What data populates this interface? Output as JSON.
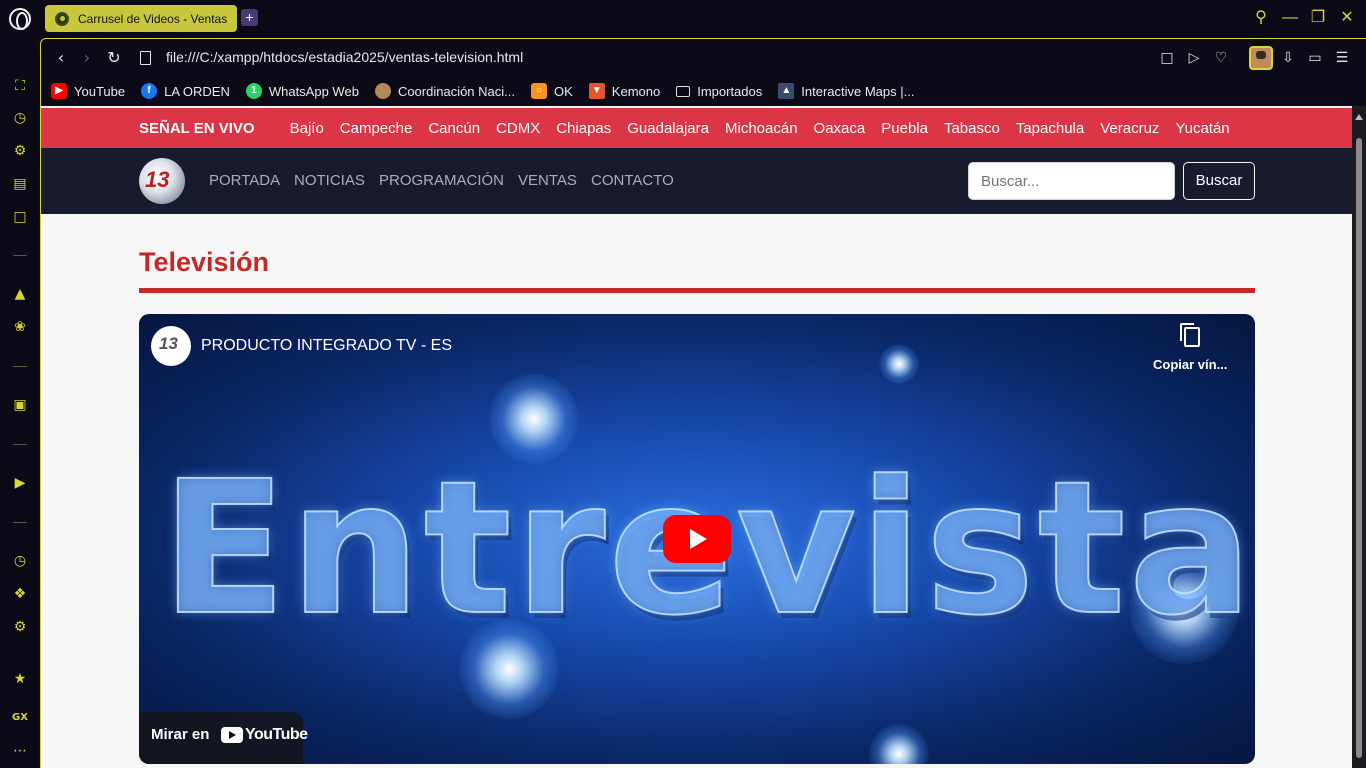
{
  "browser": {
    "tab_title": "Carrusel de Videos - Ventas",
    "new_tab": "+",
    "url": "file:///C:/xampp/htdocs/estadia2025/ventas-television.html"
  },
  "bookmarks": [
    {
      "label": "YouTube",
      "icon": "youtube-icon",
      "color": "#ff0000"
    },
    {
      "label": "LA ORDEN",
      "icon": "facebook-icon",
      "color": "#1877f2"
    },
    {
      "label": "WhatsApp Web",
      "icon": "whatsapp-icon",
      "color": "#25d366"
    },
    {
      "label": "Coordinación Naci...",
      "icon": "coordinacion-icon",
      "color": "#b08a5a"
    },
    {
      "label": "OK",
      "icon": "ok-icon",
      "color": "#f7931e"
    },
    {
      "label": "Kemono",
      "icon": "kemono-icon",
      "color": "#e4572e"
    },
    {
      "label": "Importados",
      "icon": "folder-icon",
      "color": "#0c0a16"
    },
    {
      "label": "Interactive Maps |...",
      "icon": "maps-icon",
      "color": "#3b4b6b"
    }
  ],
  "site": {
    "live_label": "SEÑAL EN VIVO",
    "regions": [
      "Bajío",
      "Campeche",
      "Cancún",
      "CDMX",
      "Chiapas",
      "Guadalajara",
      "Michoacán",
      "Oaxaca",
      "Puebla",
      "Tabasco",
      "Tapachula",
      "Veracruz",
      "Yucatán"
    ],
    "logo_text": "13",
    "nav": [
      "PORTADA",
      "NOTICIAS",
      "PROGRAMACIÓN",
      "VENTAS",
      "CONTACTO"
    ],
    "search_placeholder": "Buscar...",
    "search_button": "Buscar",
    "accent_color": "#dc3545"
  },
  "main": {
    "section_title": "Televisión",
    "video": {
      "channel_logo_text": "13",
      "title": "PRODUCTO INTEGRADO TV - ES",
      "copy_link_label": "Copiar vín...",
      "overlay_word": "Entrevista",
      "watch_on_label": "Mirar en",
      "youtube_word": "YouTube"
    }
  }
}
